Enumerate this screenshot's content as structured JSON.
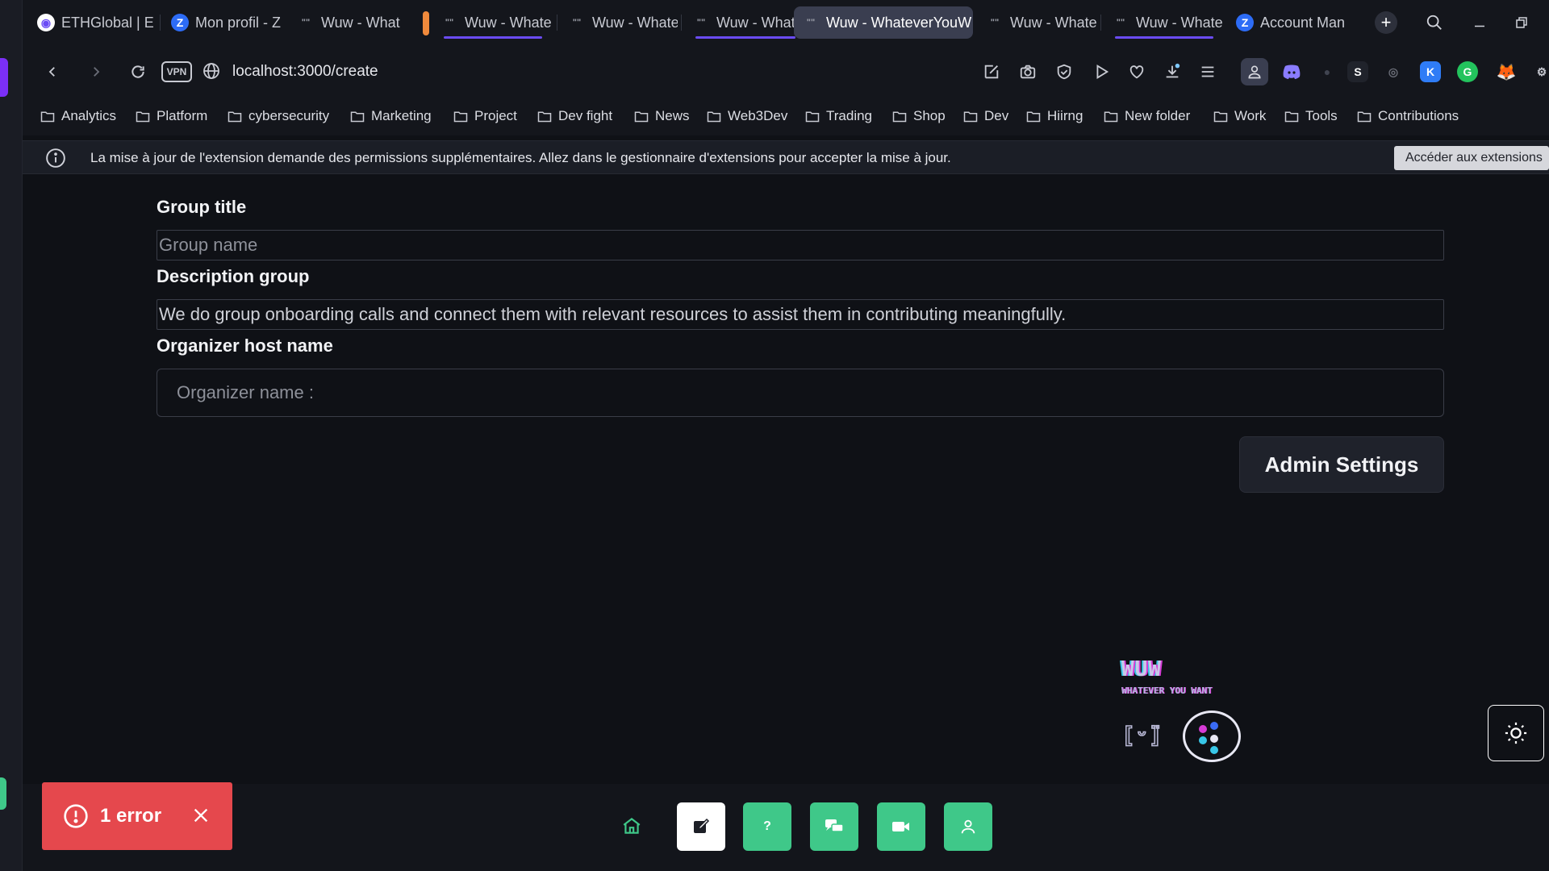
{
  "browser": {
    "tabs": [
      {
        "label": "ETHGlobal | E"
      },
      {
        "label": "Mon profil - Z"
      },
      {
        "label": "Wuw - Whate"
      },
      {
        "label": "Wuw - Whate"
      },
      {
        "label": "Wuw - Whate"
      },
      {
        "label": "Wuw - Whate"
      },
      {
        "label": "Wuw - WhateverYouW"
      },
      {
        "label": "Wuw - Whate"
      },
      {
        "label": "Wuw - Whate"
      },
      {
        "label": "Account Man"
      }
    ],
    "active_tab_index": 6,
    "vpn_label": "VPN",
    "url": "localhost:3000/create",
    "bookmarks": [
      "Analytics",
      "Platform",
      "cybersecurity",
      "Marketing",
      "Project",
      "Dev fight",
      "News",
      "Web3Dev",
      "Trading",
      "Shop",
      "Dev",
      "Hiirng",
      "New folder",
      "Work",
      "Tools",
      "Contributions"
    ]
  },
  "infobar": {
    "message": "La mise à jour de l'extension demande des permissions supplémentaires. Allez dans le gestionnaire d'extensions pour accepter la mise à jour.",
    "button_label": "Accéder aux extensions"
  },
  "form": {
    "group_title_label": "Group title",
    "group_name_placeholder": "Group name",
    "group_name_value": "",
    "description_label": "Description group",
    "description_value": "We do group onboarding calls and connect them with relevant resources to assist them in contributing meaningfully.",
    "organizer_label": "Organizer host name",
    "organizer_placeholder": "Organizer name :",
    "organizer_value": "",
    "admin_button_label": "Admin Settings"
  },
  "logo": {
    "title": "WUW",
    "tagline": "WHATEVER YOU WANT"
  },
  "error_toast": {
    "text": "1 error"
  },
  "colors": {
    "accent_green": "#3fc889",
    "error_red": "#e5484d",
    "tab_accent": "#6b4cf5"
  }
}
